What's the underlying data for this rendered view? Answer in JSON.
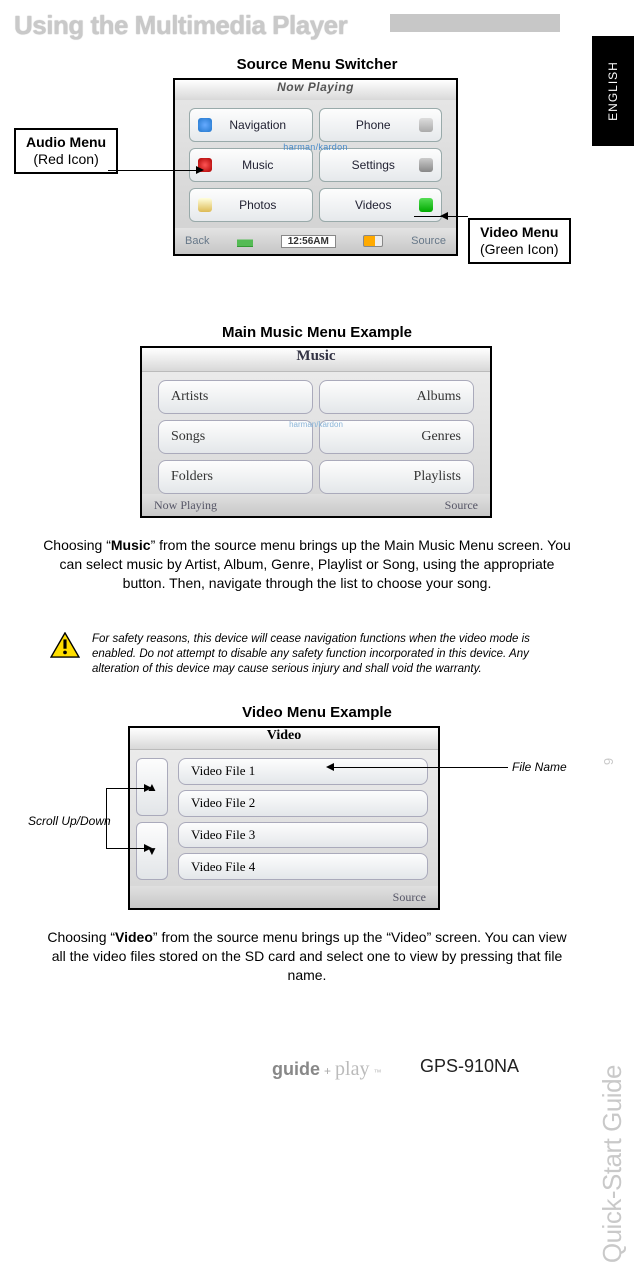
{
  "page": {
    "title": "Using the Multimedia Player",
    "language_tab": "ENGLISH",
    "side_label": "Quick-Start Guide",
    "page_number": "9",
    "model": "GPS-910NA",
    "footer_logo": {
      "word1": "guide",
      "plus": "+",
      "word2": "play",
      "tm": "™"
    }
  },
  "source_menu": {
    "section_title": "Source Menu Switcher",
    "top_label": "Now Playing",
    "center_brand": "harman/kardon",
    "bottom_left": "Back",
    "bottom_right": "Source",
    "clock": "12:56AM",
    "buttons": {
      "navigation": "Navigation",
      "phone": "Phone",
      "music": "Music",
      "settings": "Settings",
      "photos": "Photos",
      "videos": "Videos"
    },
    "callouts": {
      "audio": {
        "title": "Audio Menu",
        "sub": "(Red Icon)"
      },
      "video": {
        "title": "Video Menu",
        "sub": "(Green Icon)"
      }
    }
  },
  "music_menu": {
    "section_title": "Main Music Menu Example",
    "header": "Music",
    "center_brand": "harman/kardon",
    "foot_left": "Now Playing",
    "foot_right": "Source",
    "buttons": {
      "artists": "Artists",
      "albums": "Albums",
      "songs": "Songs",
      "genres": "Genres",
      "folders": "Folders",
      "playlists": "Playlists"
    },
    "paragraph": {
      "pre": "Choosing  “",
      "bold": "Music",
      "post": "” from the source menu brings up the  Main Music Menu screen.  You can select music by Artist, Album, Genre, Playlist or Song, using the appropriate button. Then, navigate through the list to choose your song."
    }
  },
  "warning": {
    "text": "For safety reasons, this device will cease navigation functions when the video mode is enabled.  Do not attempt to disable any safety function incorporated in this device.  Any alteration of this device may cause serious injury and shall void the warranty."
  },
  "video_menu": {
    "section_title": "Video Menu Example",
    "header": "Video",
    "foot_right": "Source",
    "files": [
      "Video File 1",
      "Video File 2",
      "Video File 3",
      "Video File 4"
    ],
    "annotations": {
      "file_name": "File Name",
      "scroll": "Scroll Up/Down"
    },
    "paragraph": {
      "pre": "Choosing  “",
      "bold": "Video",
      "post": "” from the source menu brings up the  “Video” screen.   You can view all the video files stored on the SD card and select one to view by pressing that file name."
    }
  }
}
